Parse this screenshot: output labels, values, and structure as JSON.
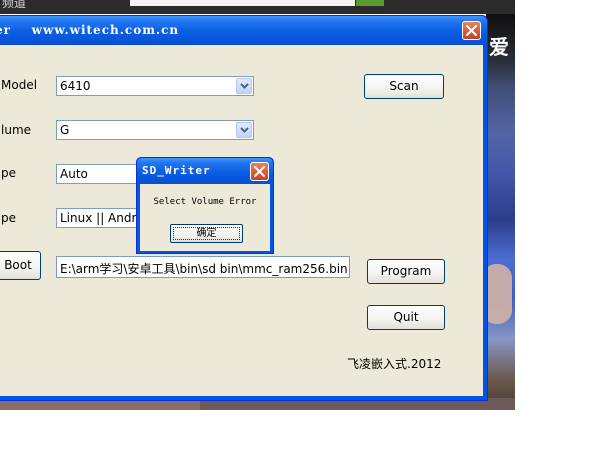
{
  "background": {
    "top_bar_text": "频道",
    "overlay_char": "爱"
  },
  "window": {
    "title": "er    www.witech.com.cn",
    "labels": {
      "model": "Model",
      "volume": "lume",
      "type1": "pe",
      "type2": "pe",
      "boot": "Boot"
    },
    "fields": {
      "model_value": "6410",
      "volume_value": "G",
      "type1_value": "Auto",
      "type2_value": "Linux || Andro",
      "boot_path": "E:\\arm学习\\安卓工具\\bin\\sd bin\\mmc_ram256.bin"
    },
    "buttons": {
      "boot_partial": "Boot",
      "scan": "Scan",
      "program": "Program",
      "quit": "Quit"
    },
    "copyright": "飞凌嵌入式.2012"
  },
  "dialog": {
    "title": "SD_Writer",
    "message": "Select Volume Error",
    "ok_label": "确定"
  },
  "colors": {
    "titlebar": "#0a5fe0",
    "window_face": "#ece9d8",
    "close_red": "#d9603a"
  },
  "icons": [
    "close-icon",
    "dropdown-arrow-icon"
  ]
}
